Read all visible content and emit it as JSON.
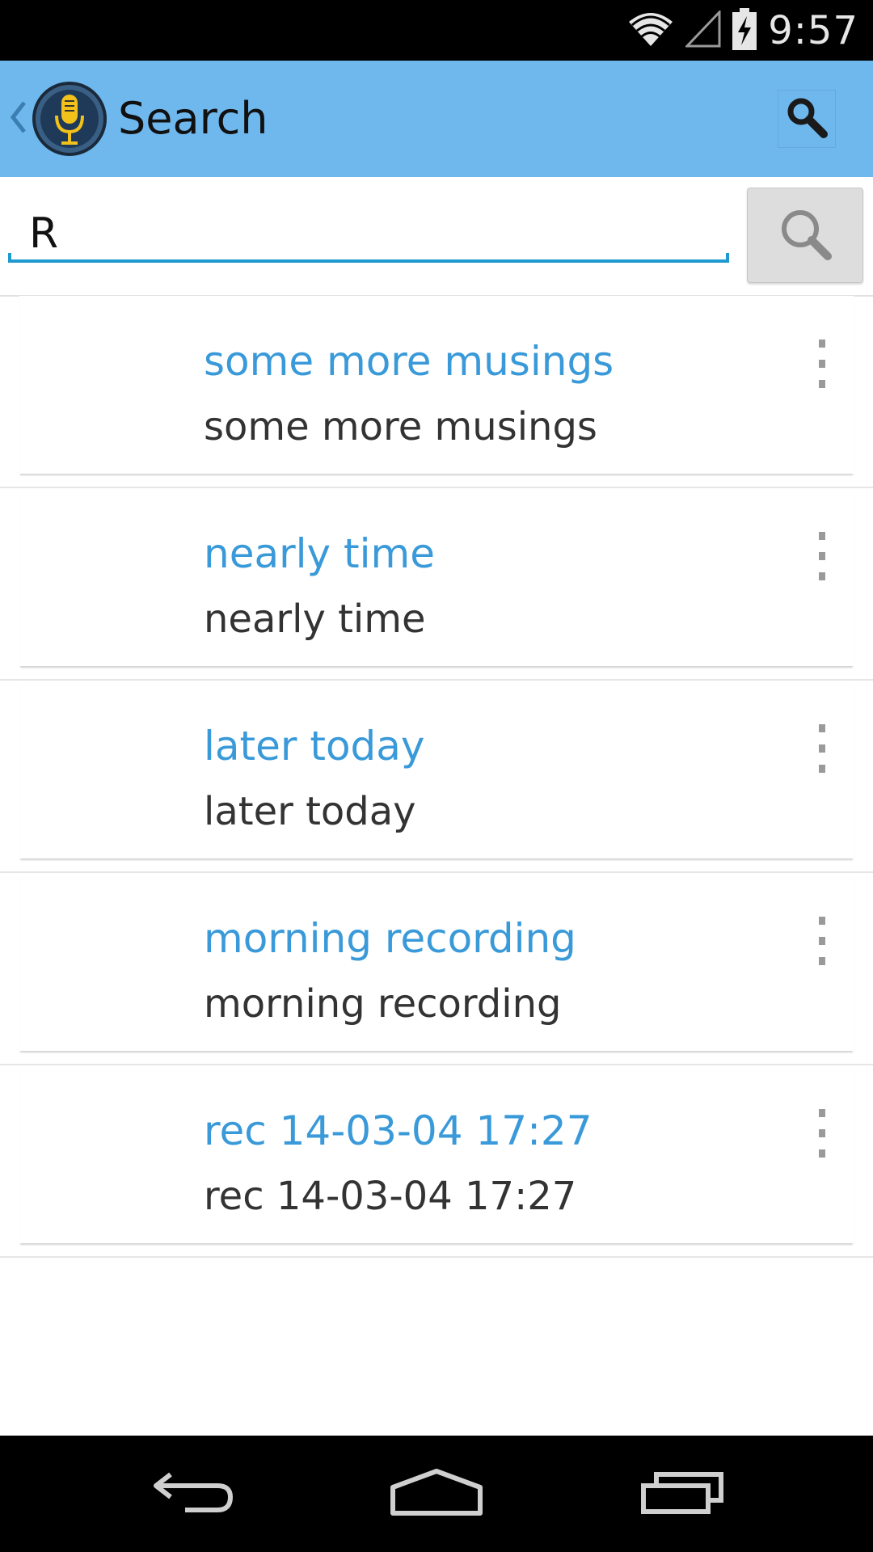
{
  "status_bar": {
    "time": "9:57",
    "icons": [
      "wifi-icon",
      "cell-signal-icon",
      "battery-charging-icon"
    ]
  },
  "action_bar": {
    "title": "Search",
    "background": "#6fb8ee",
    "icons": [
      "back-chevron-icon",
      "microphone-app-icon",
      "search-icon"
    ]
  },
  "search": {
    "value": "R",
    "placeholder": "",
    "accent": "#1e9ad0",
    "button_icon": "search-icon"
  },
  "results": [
    {
      "title": "some more musings",
      "subtitle": "some more musings"
    },
    {
      "title": "nearly time",
      "subtitle": "nearly time"
    },
    {
      "title": "later today",
      "subtitle": "later today"
    },
    {
      "title": "morning recording",
      "subtitle": "morning recording"
    },
    {
      "title": "rec 14-03-04 17:27",
      "subtitle": "rec 14-03-04 17:27"
    }
  ],
  "colors": {
    "title_text": "#3a9ad9",
    "subtitle_text": "#333333"
  },
  "nav_bar": {
    "icons": [
      "back-icon",
      "home-icon",
      "recent-apps-icon"
    ]
  }
}
